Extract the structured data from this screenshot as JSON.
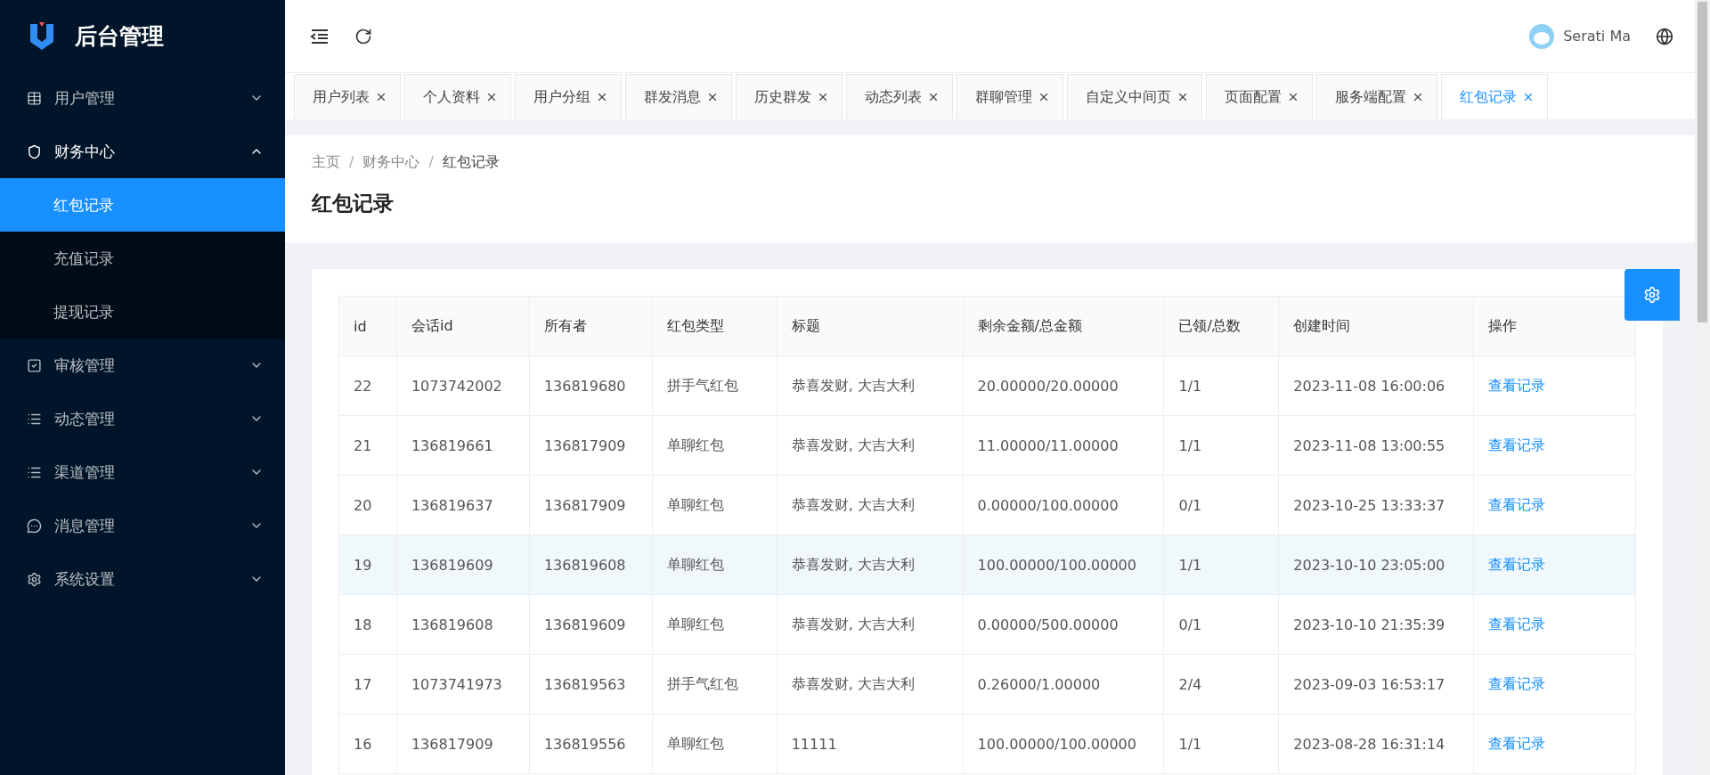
{
  "brand": {
    "title": "后台管理"
  },
  "sidebar": {
    "items": [
      {
        "label": "用户管理",
        "selected": false,
        "expanded": false
      },
      {
        "label": "财务中心",
        "selected": true,
        "expanded": true,
        "children": [
          {
            "label": "红包记录",
            "selected": true
          },
          {
            "label": "充值记录",
            "selected": false
          },
          {
            "label": "提现记录",
            "selected": false
          }
        ]
      },
      {
        "label": "审核管理",
        "selected": false,
        "expanded": false
      },
      {
        "label": "动态管理",
        "selected": false,
        "expanded": false
      },
      {
        "label": "渠道管理",
        "selected": false,
        "expanded": false
      },
      {
        "label": "消息管理",
        "selected": false,
        "expanded": false
      },
      {
        "label": "系统设置",
        "selected": false,
        "expanded": false
      }
    ]
  },
  "header": {
    "user": "Serati Ma"
  },
  "tabs": [
    {
      "label": "用户列表",
      "selected": false
    },
    {
      "label": "个人资料",
      "selected": false
    },
    {
      "label": "用户分组",
      "selected": false
    },
    {
      "label": "群发消息",
      "selected": false
    },
    {
      "label": "历史群发",
      "selected": false
    },
    {
      "label": "动态列表",
      "selected": false
    },
    {
      "label": "群聊管理",
      "selected": false
    },
    {
      "label": "自定义中间页",
      "selected": false
    },
    {
      "label": "页面配置",
      "selected": false
    },
    {
      "label": "服务端配置",
      "selected": false
    },
    {
      "label": "红包记录",
      "selected": true
    }
  ],
  "breadcrumb": {
    "separator": "/",
    "items": [
      "主页",
      "财务中心",
      "红包记录"
    ]
  },
  "page_title": "红包记录",
  "table": {
    "columns": [
      "id",
      "会话id",
      "所有者",
      "红包类型",
      "标题",
      "剩余金额/总金额",
      "已领/总数",
      "创建时间",
      "操作"
    ],
    "rows": [
      {
        "cells": [
          "22",
          "1073742002",
          "136819680",
          "拼手气红包",
          "恭喜发财, 大吉大利",
          "20.00000/20.00000",
          "1/1",
          "2023-11-08 16:00:06"
        ],
        "action": "查看记录",
        "highlighted": false
      },
      {
        "cells": [
          "21",
          "136819661",
          "136817909",
          "单聊红包",
          "恭喜发财, 大吉大利",
          "11.00000/11.00000",
          "1/1",
          "2023-11-08 13:00:55"
        ],
        "action": "查看记录",
        "highlighted": false
      },
      {
        "cells": [
          "20",
          "136819637",
          "136817909",
          "单聊红包",
          "恭喜发财, 大吉大利",
          "0.00000/100.00000",
          "0/1",
          "2023-10-25 13:33:37"
        ],
        "action": "查看记录",
        "highlighted": false
      },
      {
        "cells": [
          "19",
          "136819609",
          "136819608",
          "单聊红包",
          "恭喜发财, 大吉大利",
          "100.00000/100.00000",
          "1/1",
          "2023-10-10 23:05:00"
        ],
        "action": "查看记录",
        "highlighted": true
      },
      {
        "cells": [
          "18",
          "136819608",
          "136819609",
          "单聊红包",
          "恭喜发财, 大吉大利",
          "0.00000/500.00000",
          "0/1",
          "2023-10-10 21:35:39"
        ],
        "action": "查看记录",
        "highlighted": false
      },
      {
        "cells": [
          "17",
          "1073741973",
          "136819563",
          "拼手气红包",
          "恭喜发财, 大吉大利",
          "0.26000/1.00000",
          "2/4",
          "2023-09-03 16:53:17"
        ],
        "action": "查看记录",
        "highlighted": false
      },
      {
        "cells": [
          "16",
          "136817909",
          "136819556",
          "单聊红包",
          "11111",
          "100.00000/100.00000",
          "1/1",
          "2023-08-28 16:31:14"
        ],
        "action": "查看记录",
        "highlighted": false
      }
    ]
  }
}
